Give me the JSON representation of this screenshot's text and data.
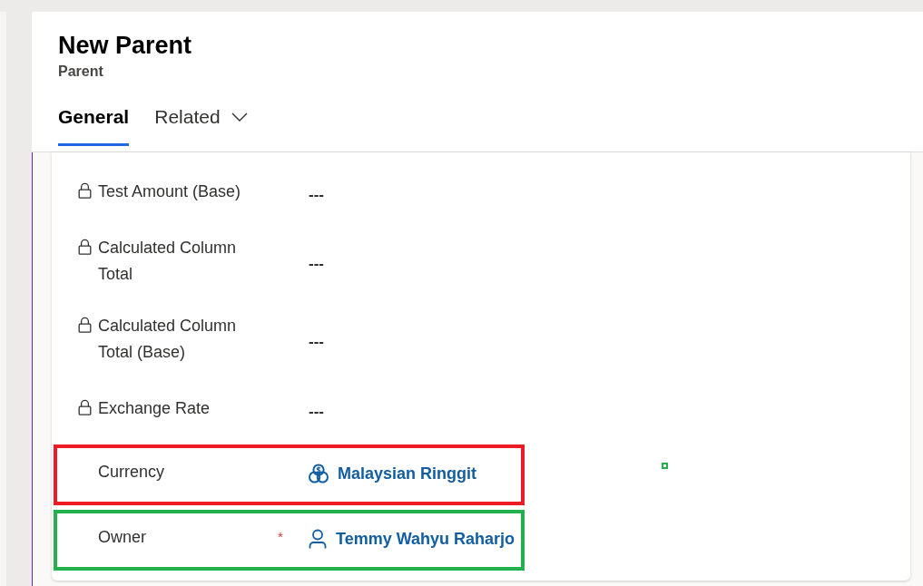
{
  "header": {
    "title": "New Parent",
    "entity": "Parent"
  },
  "tabs": [
    {
      "label": "General",
      "selected": true,
      "dropdown": false
    },
    {
      "label": "Related",
      "selected": false,
      "dropdown": true
    }
  ],
  "fields": [
    {
      "label": "Test Amount (Base)",
      "value": "---",
      "locked": true,
      "kind": "text"
    },
    {
      "label": "Calculated Column Total",
      "value": "---",
      "locked": true,
      "kind": "text"
    },
    {
      "label": "Calculated Column Total (Base)",
      "value": "---",
      "locked": true,
      "kind": "text"
    },
    {
      "label": "Exchange Rate",
      "value": "---",
      "locked": true,
      "kind": "text"
    },
    {
      "label": "Currency",
      "value": "Malaysian Ringgit",
      "locked": false,
      "kind": "currency",
      "color": "#ed1c24"
    },
    {
      "label": "Owner",
      "value": "Temmy Wahyu Raharjo",
      "locked": false,
      "kind": "user",
      "required_mark": "*",
      "color": "#22b14c"
    }
  ]
}
